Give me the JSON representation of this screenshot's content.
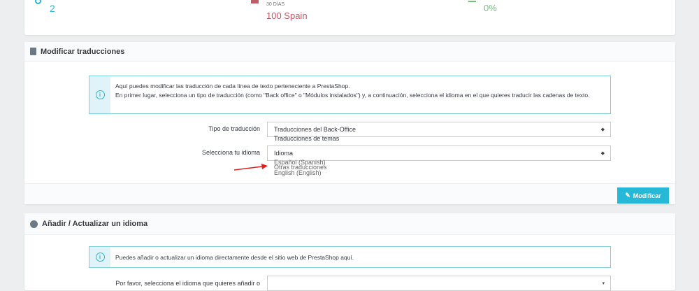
{
  "stats": {
    "stat1_value": "2",
    "stat2_period": "30 DÍAS",
    "stat2_value": "100 Spain",
    "stat3_value": "0%",
    "colors": {
      "blue": "#25b9d7",
      "red": "#c05c67",
      "green": "#72c279"
    }
  },
  "modify": {
    "title": "Modificar traducciones",
    "info_lines": [
      "Aquí puedes modificar las traducción de cada línea de texto perteneciente a PrestaShop.",
      "En primer lugar, selecciona un tipo de traducción (como \"Back office\" o \"Módulos instalados\") y, a continuación, selecciona el idioma en el que quieres traducir las cadenas de texto."
    ],
    "type_label": "Tipo de traducción",
    "type_value": "Traducciones del Back-Office",
    "type_overflow_option": "Traducciones de temas",
    "lang_label": "Selecciona tu idioma",
    "lang_value": "Idioma",
    "lang_options": [
      "Español (Spanish)",
      "Otras traducciones",
      "English (English)"
    ],
    "button": "Modificar"
  },
  "add": {
    "title": "Añadir / Actualizar un idioma",
    "info": "Puedes añadir o actualizar un idioma directamente desde el sitio web de PrestaShop aquí.",
    "select_label": "Por favor, selecciona el idioma que quieres añadir o"
  }
}
